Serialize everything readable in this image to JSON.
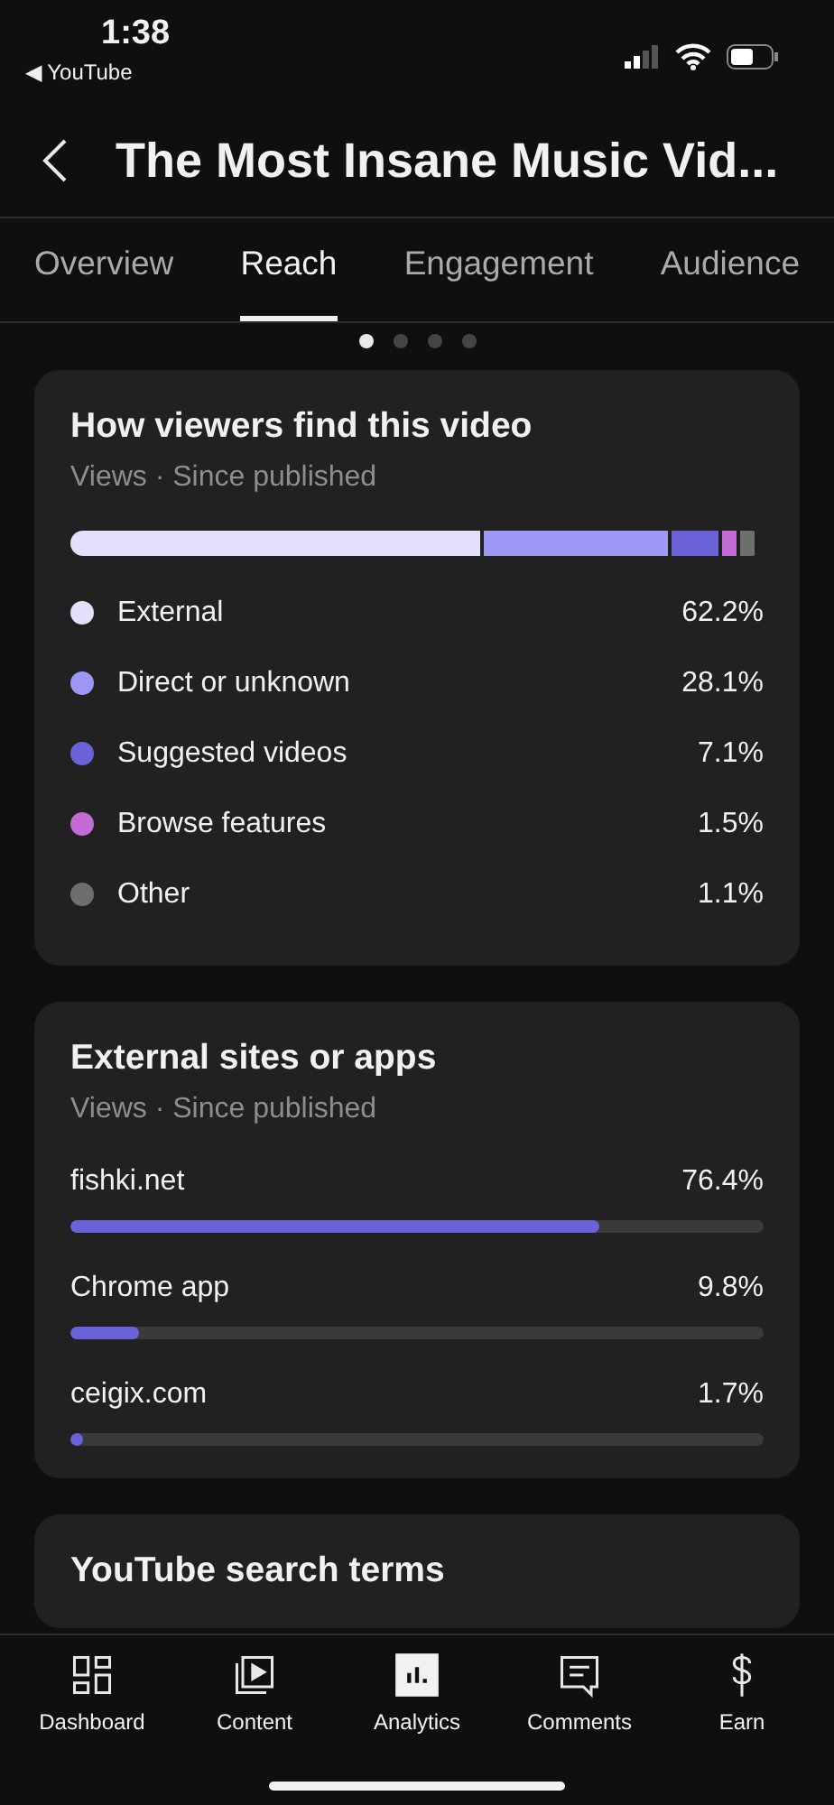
{
  "status_bar": {
    "time": "1:38",
    "back_app": "◀ YouTube"
  },
  "header": {
    "title": "The Most Insane Music Vid..."
  },
  "tabs": [
    {
      "label": "Overview",
      "selected": false
    },
    {
      "label": "Reach",
      "selected": true
    },
    {
      "label": "Engagement",
      "selected": false
    },
    {
      "label": "Audience",
      "selected": false
    }
  ],
  "pager": [
    {
      "selected": true
    },
    {
      "selected": false
    },
    {
      "selected": false
    },
    {
      "selected": false
    }
  ],
  "traffic_card": {
    "title": "How viewers find this video",
    "subtitle": "Views · Since published",
    "sources": [
      {
        "label": "External",
        "value": "62.2%",
        "color": "#e4e0fb"
      },
      {
        "label": "Direct or unknown",
        "value": "28.1%",
        "color": "#9f97f5"
      },
      {
        "label": "Suggested videos",
        "value": "7.1%",
        "color": "#6a62d8"
      },
      {
        "label": "Browse features",
        "value": "1.5%",
        "color": "#c46ad6"
      },
      {
        "label": "Other",
        "value": "1.1%",
        "color": "#6e6e6e"
      }
    ]
  },
  "external_card": {
    "title": "External sites or apps",
    "subtitle": "Views · Since published",
    "sites": [
      {
        "name": "fishki.net",
        "value": "76.4%",
        "level": 0.764
      },
      {
        "name": "Chrome app",
        "value": "9.8%",
        "level": 0.098
      },
      {
        "name": "ceigix.com",
        "value": "1.7%",
        "level": 0.017
      }
    ]
  },
  "search_card": {
    "title": "YouTube search terms"
  },
  "bottom_nav": [
    {
      "label": "Dashboard",
      "kind": "dashboard",
      "selected": false
    },
    {
      "label": "Content",
      "kind": "content",
      "selected": false
    },
    {
      "label": "Analytics",
      "kind": "analytics",
      "selected": true
    },
    {
      "label": "Comments",
      "kind": "comments",
      "selected": false
    },
    {
      "label": "Earn",
      "kind": "earn",
      "selected": false
    }
  ]
}
